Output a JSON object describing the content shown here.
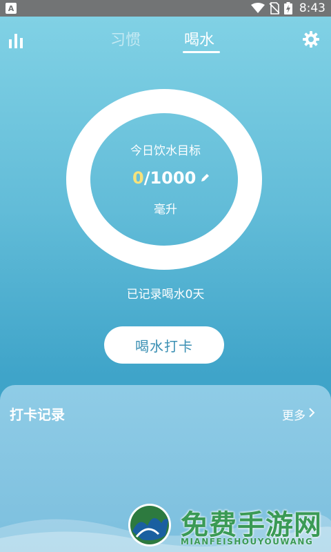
{
  "status_bar": {
    "app_icon_letter": "A",
    "time": "8:43"
  },
  "nav": {
    "tabs": [
      {
        "label": "习惯",
        "active": false
      },
      {
        "label": "喝水",
        "active": true
      }
    ],
    "stats_icon": "bar-chart-icon",
    "settings_icon": "gear-icon"
  },
  "goal": {
    "title": "今日饮水目标",
    "current": "0",
    "target": "/1000",
    "unit": "毫升",
    "edit_icon": "pencil-icon"
  },
  "record_days_text": "已记录喝水0天",
  "checkin_button": "喝水打卡",
  "records": {
    "title": "打卡记录",
    "more": "更多"
  },
  "watermark": {
    "name": "免费手游网",
    "sub": "MIANFEISHOUYOUWANG"
  },
  "colors": {
    "accent_current": "#f6e27b",
    "button_text": "#3a8fb3",
    "watermark": "#3a9a55"
  }
}
